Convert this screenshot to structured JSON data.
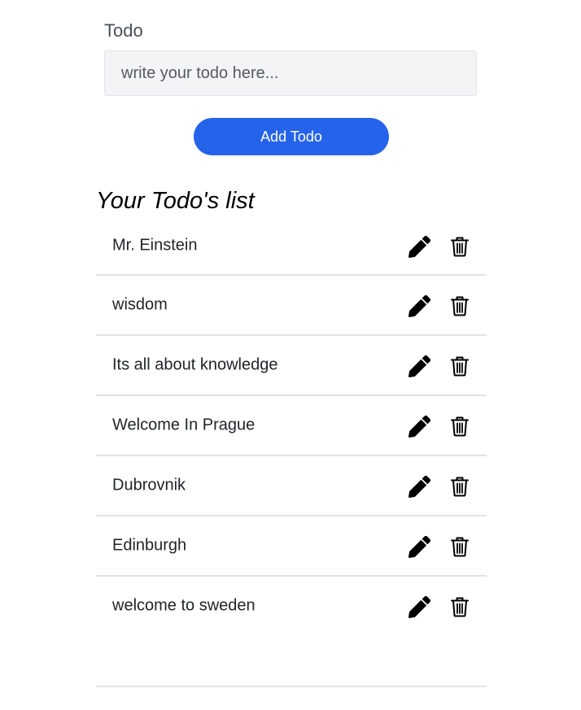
{
  "form": {
    "label": "Todo",
    "input_placeholder": "write your todo here...",
    "input_value": "",
    "add_button_label": "Add Todo"
  },
  "list": {
    "title": "Your Todo's list",
    "items": [
      {
        "text": "Mr. Einstein"
      },
      {
        "text": "wisdom"
      },
      {
        "text": "Its all about knowledge"
      },
      {
        "text": "Welcome In Prague"
      },
      {
        "text": "Dubrovnik"
      },
      {
        "text": "Edinburgh"
      },
      {
        "text": "welcome to sweden"
      }
    ],
    "edit_icon": "pencil-icon",
    "delete_icon": "trash-icon"
  },
  "colors": {
    "accent": "#2563eb",
    "input_background": "#f3f4f6",
    "divider": "#e3e3e3"
  }
}
